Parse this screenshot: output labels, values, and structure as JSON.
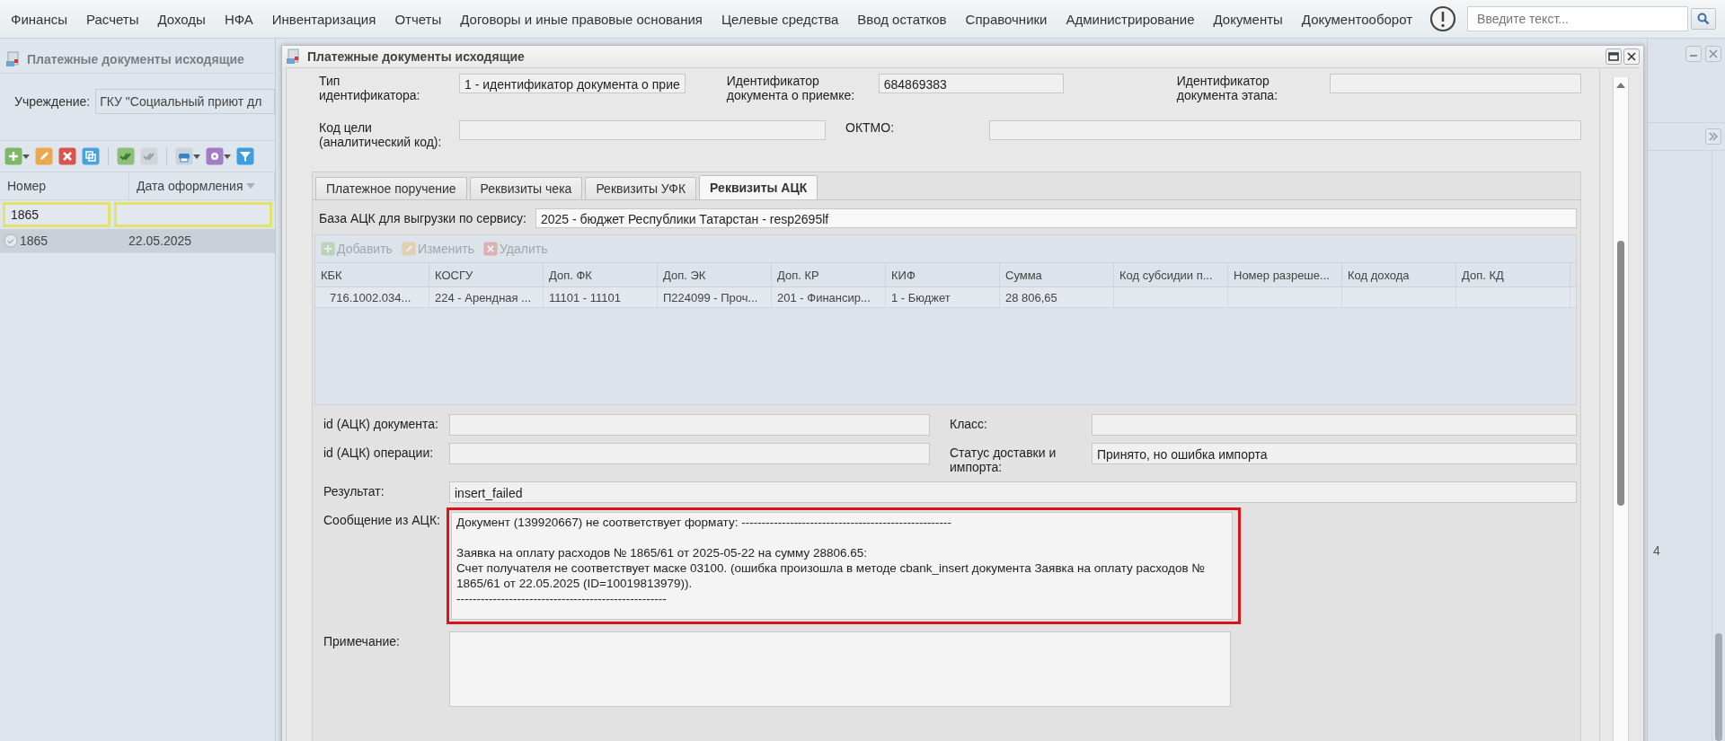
{
  "menu": {
    "items": [
      "Финансы",
      "Расчеты",
      "Доходы",
      "НФА",
      "Инвентаризация",
      "Отчеты",
      "Договоры и иные правовые основания",
      "Целевые средства",
      "Ввод остатков",
      "Справочники",
      "Администрирование",
      "Документы",
      "Документооборот"
    ],
    "search": {
      "placeholder": "Введите текст..."
    }
  },
  "background_window": {
    "title": "Платежные документы исходящие",
    "institution": {
      "label": "Учреждение:",
      "value": "ГКУ \"Социальный приют дл"
    },
    "table": {
      "columns": [
        {
          "label": "Номер",
          "sorted": false
        },
        {
          "label": "Дата оформления",
          "sorted": true
        }
      ],
      "filter_values": [
        "1865"
      ],
      "rows": [
        {
          "cells": [
            "1865",
            "22.05.2025"
          ],
          "selected": true
        }
      ]
    }
  },
  "side_panel": {
    "cell_text": "4"
  },
  "dialog": {
    "title": "Платежные документы исходящие",
    "header_rows": [
      [
        {
          "label": "Тип\nидентификатора:",
          "value": "1 - идентификатор документа о прие"
        },
        {
          "label": "Идентификатор\nдокумента о приемке:",
          "value": "684869383"
        },
        {
          "label": "Идентификатор\nдокумента этапа:"
        }
      ],
      [
        {
          "label": "Код цели\n(аналитический код):"
        },
        {
          "label": "ОКТМО:"
        }
      ]
    ],
    "tabs": [
      {
        "label": "Платежное поручение",
        "selected": false
      },
      {
        "label": "Реквизиты чека",
        "selected": false
      },
      {
        "label": "Реквизиты УФК",
        "selected": false
      },
      {
        "label": "Реквизиты АЦК",
        "selected": true
      }
    ],
    "base": {
      "label": "База АЦК для выгрузки по сервису:",
      "value": "2025 - бюджет Республики Татарстан - resp2695lf"
    },
    "grid_toolbar": [
      {
        "kind": "add",
        "label": "Добавить",
        "disabled": true
      },
      {
        "kind": "edit",
        "label": "Изменить",
        "disabled": true
      },
      {
        "kind": "delete",
        "label": "Удалить",
        "disabled": true
      }
    ],
    "grid": {
      "columns": [
        "КБК",
        "КОСГУ",
        "Доп. ФК",
        "Доп. ЭК",
        "Доп. КР",
        "КИФ",
        "Сумма",
        "Код субсидии п...",
        "Номер разреше...",
        "Код дохода",
        "Доп. КД"
      ],
      "rows": [
        {
          "cells": [
            "716.1002.034...",
            "224 - Арендная ...",
            "11101 - 11101",
            "П224099 - Проч...",
            "201 - Финансир...",
            "1 - Бюджет",
            "28 806,65"
          ]
        }
      ]
    },
    "detail_rows": [
      [
        {
          "kind": "input",
          "label": "id (АЦК) документа:"
        },
        {
          "kind": "input",
          "label": "Класс:"
        }
      ],
      [
        {
          "kind": "input",
          "label": "id (АЦК) операции:"
        },
        {
          "kind": "input",
          "label": "Статус доставки и\nимпорта:",
          "value": "Принято, но ошибка импорта"
        }
      ],
      [
        {
          "kind": "input",
          "label": "Результат:",
          "value": "insert_failed"
        }
      ],
      [
        {
          "kind": "textarea",
          "label": "Сообщение из АЦК:",
          "highlighted": true,
          "value": "Документ (139920667) не соответствует формату: ----------------------------------------------------\n\nЗаявка на оплату расходов № 1865/61 от 2025-05-22 на сумму 28806.65:\nСчет получателя не соответствует маске 03100. (ошибка произошла в методе cbank_insert документа Заявка на оплату расходов № 1865/61 от 22.05.2025 (ID=10019813979)).\n----------------------------------------------------"
        }
      ],
      [
        {
          "kind": "textarea",
          "label": "Примечание:",
          "highlighted": false
        }
      ]
    ]
  }
}
